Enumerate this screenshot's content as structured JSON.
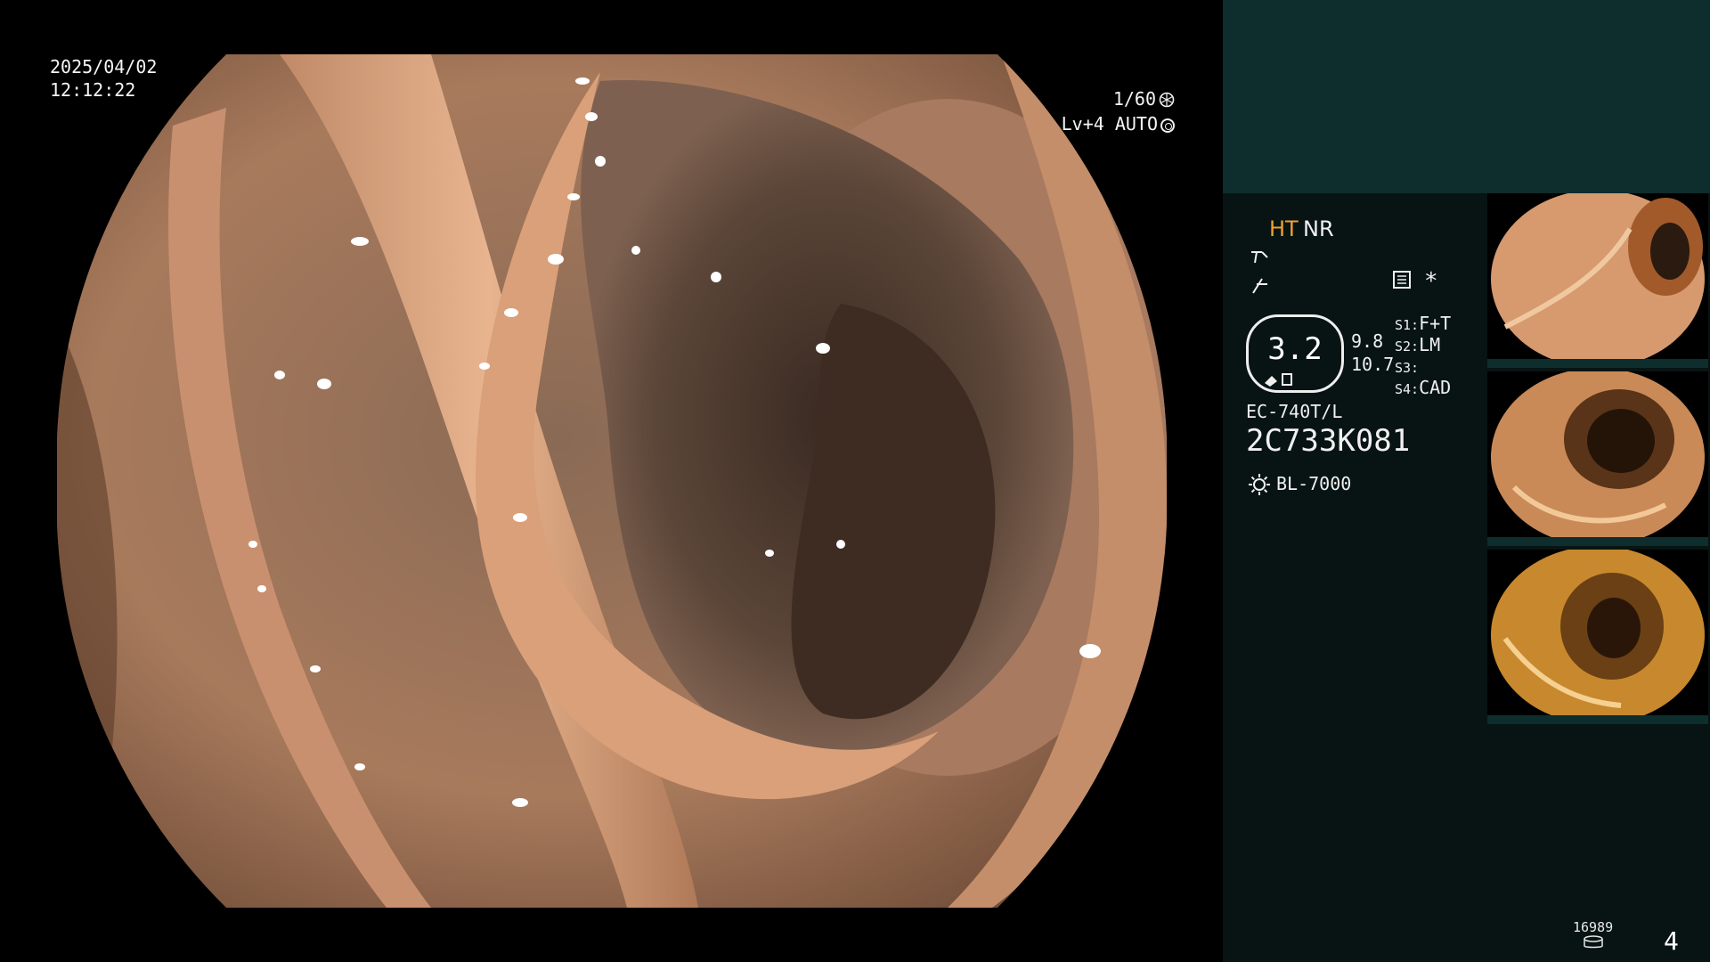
{
  "osd": {
    "date": "2025/04/02",
    "time": "12:12:22",
    "shutter": "1/60",
    "level": "Lv+4 AUTO"
  },
  "panel": {
    "ht": "HT",
    "nr": "NR",
    "zoom": "3.2",
    "zoom_a": "9.8",
    "zoom_b": "10.7",
    "switches": [
      {
        "key": "S1:",
        "value": "F+T"
      },
      {
        "key": "S2:",
        "value": "LM"
      },
      {
        "key": "S3:",
        "value": ""
      },
      {
        "key": "S4:",
        "value": "CAD"
      }
    ],
    "scope_model": "EC-740T/L",
    "scope_serial": "2C733K081",
    "light_source": "BL-7000",
    "star": "*"
  },
  "footer": {
    "count": "16989",
    "page": "4"
  },
  "colors": {
    "panel_bg": "#071413",
    "panel_top": "#0e2d2d",
    "ht_accent": "#f0a030"
  },
  "icons": [
    "shutter-icon",
    "auto-iris-icon",
    "structure-icon",
    "edge-icon",
    "memo-icon",
    "zoom-scope-icon",
    "light-icon",
    "disk-icon"
  ]
}
